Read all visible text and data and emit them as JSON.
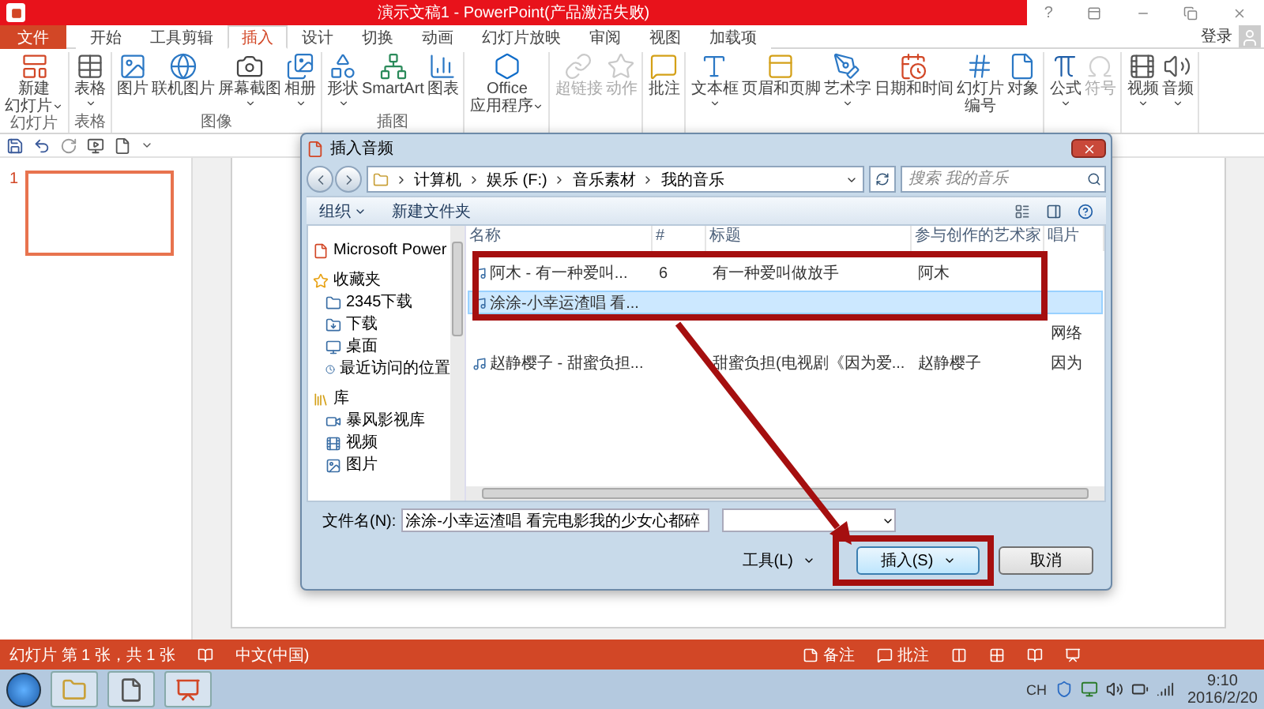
{
  "window": {
    "title": "演示文稿1 - PowerPoint(产品激活失败)",
    "help": "?"
  },
  "tabs": [
    {
      "label": "文件",
      "kind": "file",
      "selected": false
    },
    {
      "label": "开始",
      "kind": "tab",
      "selected": false
    },
    {
      "label": "工具剪辑",
      "kind": "tab",
      "selected": false
    },
    {
      "label": "插入",
      "kind": "tab",
      "selected": true
    },
    {
      "label": "设计",
      "kind": "tab",
      "selected": false
    },
    {
      "label": "切换",
      "kind": "tab",
      "selected": false
    },
    {
      "label": "动画",
      "kind": "tab",
      "selected": false
    },
    {
      "label": "幻灯片放映",
      "kind": "tab",
      "selected": false
    },
    {
      "label": "审阅",
      "kind": "tab",
      "selected": false
    },
    {
      "label": "视图",
      "kind": "tab",
      "selected": false
    },
    {
      "label": "加载项",
      "kind": "tab",
      "selected": false
    }
  ],
  "account": {
    "label": "登录"
  },
  "ribbon": {
    "groups": [
      {
        "label": "幻灯片",
        "buttons": [
          {
            "lines": [
              "新建",
              "幻灯片"
            ],
            "dropdown": true,
            "disabled": false
          }
        ]
      },
      {
        "label": "表格",
        "buttons": [
          {
            "lines": [
              "表格"
            ],
            "dropdown": true,
            "disabled": false
          }
        ]
      },
      {
        "label": "图像",
        "buttons": [
          {
            "lines": [
              "图片"
            ],
            "dropdown": false,
            "disabled": false
          },
          {
            "lines": [
              "联机图片"
            ],
            "dropdown": false,
            "disabled": false
          },
          {
            "lines": [
              "屏幕截图"
            ],
            "dropdown": true,
            "disabled": false
          },
          {
            "lines": [
              "相册"
            ],
            "dropdown": true,
            "disabled": false
          }
        ]
      },
      {
        "label": "插图",
        "buttons": [
          {
            "lines": [
              "形状"
            ],
            "dropdown": true,
            "disabled": false
          },
          {
            "lines": [
              "SmartArt"
            ],
            "dropdown": false,
            "disabled": false
          },
          {
            "lines": [
              "图表"
            ],
            "dropdown": false,
            "disabled": false
          }
        ]
      },
      {
        "buttons": [
          {
            "lines": [
              "Office",
              "应用程序"
            ],
            "dropdown": true,
            "disabled": false
          }
        ]
      },
      {
        "buttons": [
          {
            "lines": [
              "超链接"
            ],
            "dropdown": false,
            "disabled": true
          },
          {
            "lines": [
              "动作"
            ],
            "dropdown": false,
            "disabled": true
          }
        ]
      },
      {
        "buttons": [
          {
            "lines": [
              "批注"
            ],
            "dropdown": false,
            "disabled": false
          }
        ]
      },
      {
        "buttons": [
          {
            "lines": [
              "文本框"
            ],
            "dropdown": true,
            "disabled": false
          },
          {
            "lines": [
              "页眉和页脚"
            ],
            "dropdown": false,
            "disabled": false
          },
          {
            "lines": [
              "艺术字"
            ],
            "dropdown": true,
            "disabled": false
          },
          {
            "lines": [
              "日期和时间"
            ],
            "dropdown": false,
            "disabled": false
          },
          {
            "lines": [
              "幻灯片",
              "编号"
            ],
            "dropdown": false,
            "disabled": false
          },
          {
            "lines": [
              "对象"
            ],
            "dropdown": false,
            "disabled": false
          }
        ]
      },
      {
        "buttons": [
          {
            "lines": [
              "公式"
            ],
            "dropdown": true,
            "disabled": false
          },
          {
            "lines": [
              "符号"
            ],
            "dropdown": false,
            "disabled": true
          }
        ]
      },
      {
        "buttons": [
          {
            "lines": [
              "视频"
            ],
            "dropdown": true,
            "disabled": false
          },
          {
            "lines": [
              "音频"
            ],
            "dropdown": true,
            "disabled": false
          }
        ]
      }
    ]
  },
  "slides": [
    {
      "number": "1",
      "selected": true
    }
  ],
  "status_bar": {
    "slide_info": "幻灯片 第 1 张，共 1 张",
    "language": "中文(中国)",
    "notes": "备注",
    "comments": "批注"
  },
  "taskbar": {
    "input": "CH",
    "time": "9:10",
    "date": "2016/2/20"
  },
  "dialog": {
    "title": "插入音频",
    "path": [
      "计算机",
      "娱乐 (F:)",
      "音乐素材",
      "我的音乐"
    ],
    "search": {
      "placeholder": "搜索 我的音乐"
    },
    "organize": "组织",
    "new_folder": "新建文件夹",
    "nav": [
      {
        "label": "Microsoft Power",
        "kind": "app"
      },
      {
        "label": "收藏夹",
        "kind": "favorites",
        "children": [
          {
            "label": "2345下载"
          },
          {
            "label": "下载"
          },
          {
            "label": "桌面"
          },
          {
            "label": "最近访问的位置"
          }
        ]
      },
      {
        "label": "库",
        "kind": "library",
        "children": [
          {
            "label": "暴风影视库"
          },
          {
            "label": "视频"
          },
          {
            "label": "图片"
          }
        ]
      }
    ],
    "columns": [
      "名称",
      "#",
      "标题",
      "参与创作的艺术家",
      "唱片"
    ],
    "rows": [
      {
        "name": "阿木 - 有一种爱叫...",
        "number": "6",
        "title": "有一种爱叫做放手",
        "artist": "阿木",
        "selected": false
      },
      {
        "name": "涂涂-小幸运渣唱 看...",
        "selected": true
      },
      {
        "album": "网络",
        "selected": false
      },
      {
        "name": "赵静樱子 - 甜蜜负担...",
        "title": "甜蜜负担(电视剧《因为爱...",
        "artist": "赵静樱子",
        "album": "因为",
        "selected": false
      }
    ],
    "file_name": {
      "label": "文件名(N):",
      "value": "涂涂-小幸运渣唱 看完电影我的少女心都碎"
    },
    "tools": "工具(L)",
    "insert": "插入(S)",
    "cancel": "取消"
  }
}
